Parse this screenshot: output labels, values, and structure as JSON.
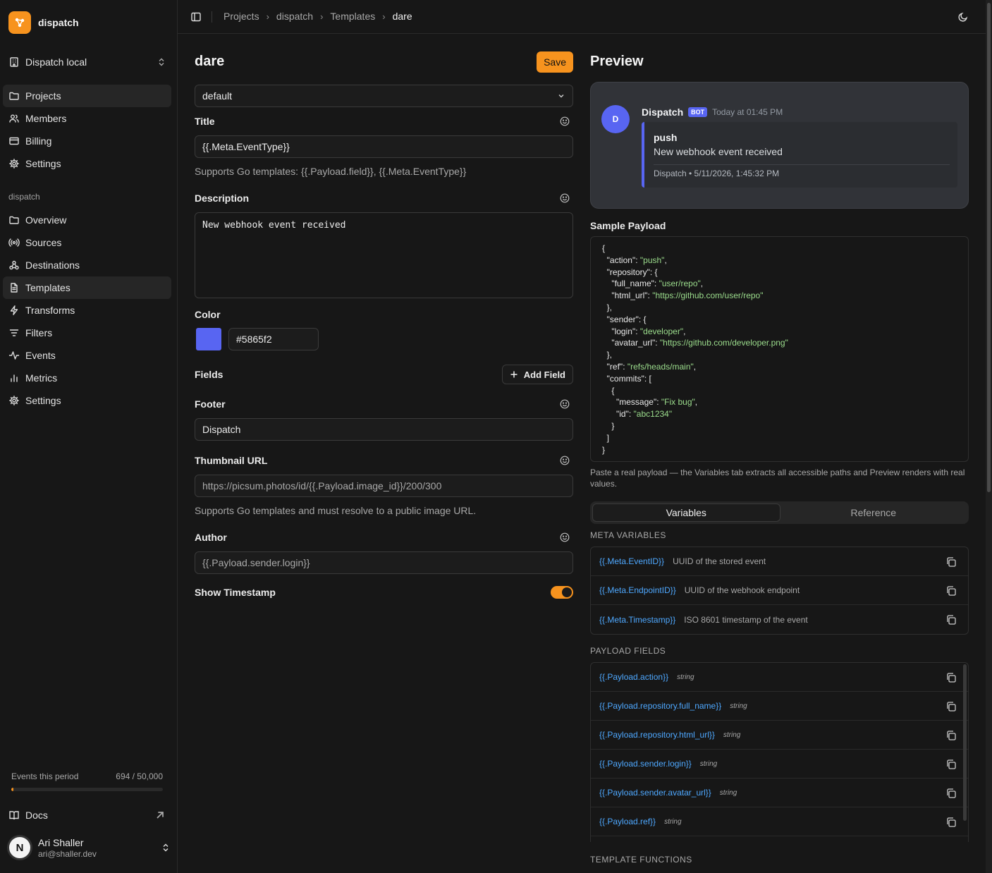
{
  "app": {
    "name": "dispatch"
  },
  "org": {
    "name": "Dispatch local"
  },
  "account_nav": [
    {
      "label": "Projects",
      "icon": "folder-icon",
      "active": true
    },
    {
      "label": "Members",
      "icon": "users-icon"
    },
    {
      "label": "Billing",
      "icon": "credit-card-icon"
    },
    {
      "label": "Settings",
      "icon": "gear-icon"
    }
  ],
  "project_section": "dispatch",
  "project_nav": [
    {
      "label": "Overview",
      "icon": "folder-icon"
    },
    {
      "label": "Sources",
      "icon": "radio-icon"
    },
    {
      "label": "Destinations",
      "icon": "webhook-icon"
    },
    {
      "label": "Templates",
      "icon": "file-text-icon",
      "active": true
    },
    {
      "label": "Transforms",
      "icon": "zap-icon"
    },
    {
      "label": "Filters",
      "icon": "filter-icon"
    },
    {
      "label": "Events",
      "icon": "activity-icon"
    },
    {
      "label": "Metrics",
      "icon": "bar-chart-icon"
    },
    {
      "label": "Settings",
      "icon": "gear-icon"
    }
  ],
  "usage": {
    "label": "Events this period",
    "value": "694 / 50,000",
    "fraction": 0.0139
  },
  "docs": {
    "label": "Docs"
  },
  "user": {
    "initial": "N",
    "name": "Ari Shaller",
    "email": "ari@shaller.dev"
  },
  "breadcrumb": [
    "Projects",
    "dispatch",
    "Templates",
    "dare"
  ],
  "editor": {
    "title": "dare",
    "save_label": "Save",
    "variant": "default",
    "title_label": "Title",
    "title_value": "{{.Meta.EventType}}",
    "title_help": "Supports Go templates: {{.Payload.field}}, {{.Meta.EventType}}",
    "description_label": "Description",
    "description_value": "New webhook event received",
    "color_label": "Color",
    "color_value": "#5865f2",
    "fields_label": "Fields",
    "add_field_label": "Add Field",
    "footer_label": "Footer",
    "footer_value": "Dispatch",
    "thumbnail_label": "Thumbnail URL",
    "thumbnail_placeholder": "https://picsum.photos/id/{{.Payload.image_id}}/200/300",
    "thumbnail_help": "Supports Go templates and must resolve to a public image URL.",
    "author_label": "Author",
    "author_placeholder": "{{.Payload.sender.login}}",
    "timestamp_label": "Show Timestamp",
    "timestamp_on": true
  },
  "preview": {
    "heading": "Preview",
    "avatar_initial": "D",
    "bot_name": "Dispatch",
    "bot_badge": "BOT",
    "time": "Today at 01:45 PM",
    "embed_title": "push",
    "embed_description": "New webhook event received",
    "embed_footer": "Dispatch • 5/11/2026, 1:45:32 PM",
    "accent": "#5865f2"
  },
  "sample_payload": {
    "label": "Sample Payload",
    "lines": [
      "{",
      "  \"action\": \"push\",",
      "  \"repository\": {",
      "    \"full_name\": \"user/repo\",",
      "    \"html_url\": \"https://github.com/user/repo\"",
      "  },",
      "  \"sender\": {",
      "    \"login\": \"developer\",",
      "    \"avatar_url\": \"https://github.com/developer.png\"",
      "  },",
      "  \"ref\": \"refs/heads/main\",",
      "  \"commits\": [",
      "    {",
      "      \"message\": \"Fix bug\",",
      "      \"id\": \"abc1234\"",
      "    }",
      "  ]",
      "}"
    ],
    "note": "Paste a real payload — the Variables tab extracts all accessible paths and Preview renders with real values."
  },
  "tabs": [
    "Variables",
    "Reference"
  ],
  "meta_variables_label": "META VARIABLES",
  "meta_variables": [
    {
      "name": "{{.Meta.EventID}}",
      "desc": "UUID of the stored event"
    },
    {
      "name": "{{.Meta.EndpointID}}",
      "desc": "UUID of the webhook endpoint"
    },
    {
      "name": "{{.Meta.Timestamp}}",
      "desc": "ISO 8601 timestamp of the event"
    }
  ],
  "payload_fields_label": "PAYLOAD FIELDS",
  "payload_fields": [
    {
      "name": "{{.Payload.action}}",
      "type": "string"
    },
    {
      "name": "{{.Payload.repository.full_name}}",
      "type": "string"
    },
    {
      "name": "{{.Payload.repository.html_url}}",
      "type": "string"
    },
    {
      "name": "{{.Payload.sender.login}}",
      "type": "string"
    },
    {
      "name": "{{.Payload.sender.avatar_url}}",
      "type": "string"
    },
    {
      "name": "{{.Payload.ref}}",
      "type": "string"
    }
  ],
  "template_functions_label": "TEMPLATE FUNCTIONS",
  "colors": {
    "accent": "#f7931e",
    "discord": "#5865f2",
    "link": "#4ea8ff"
  }
}
